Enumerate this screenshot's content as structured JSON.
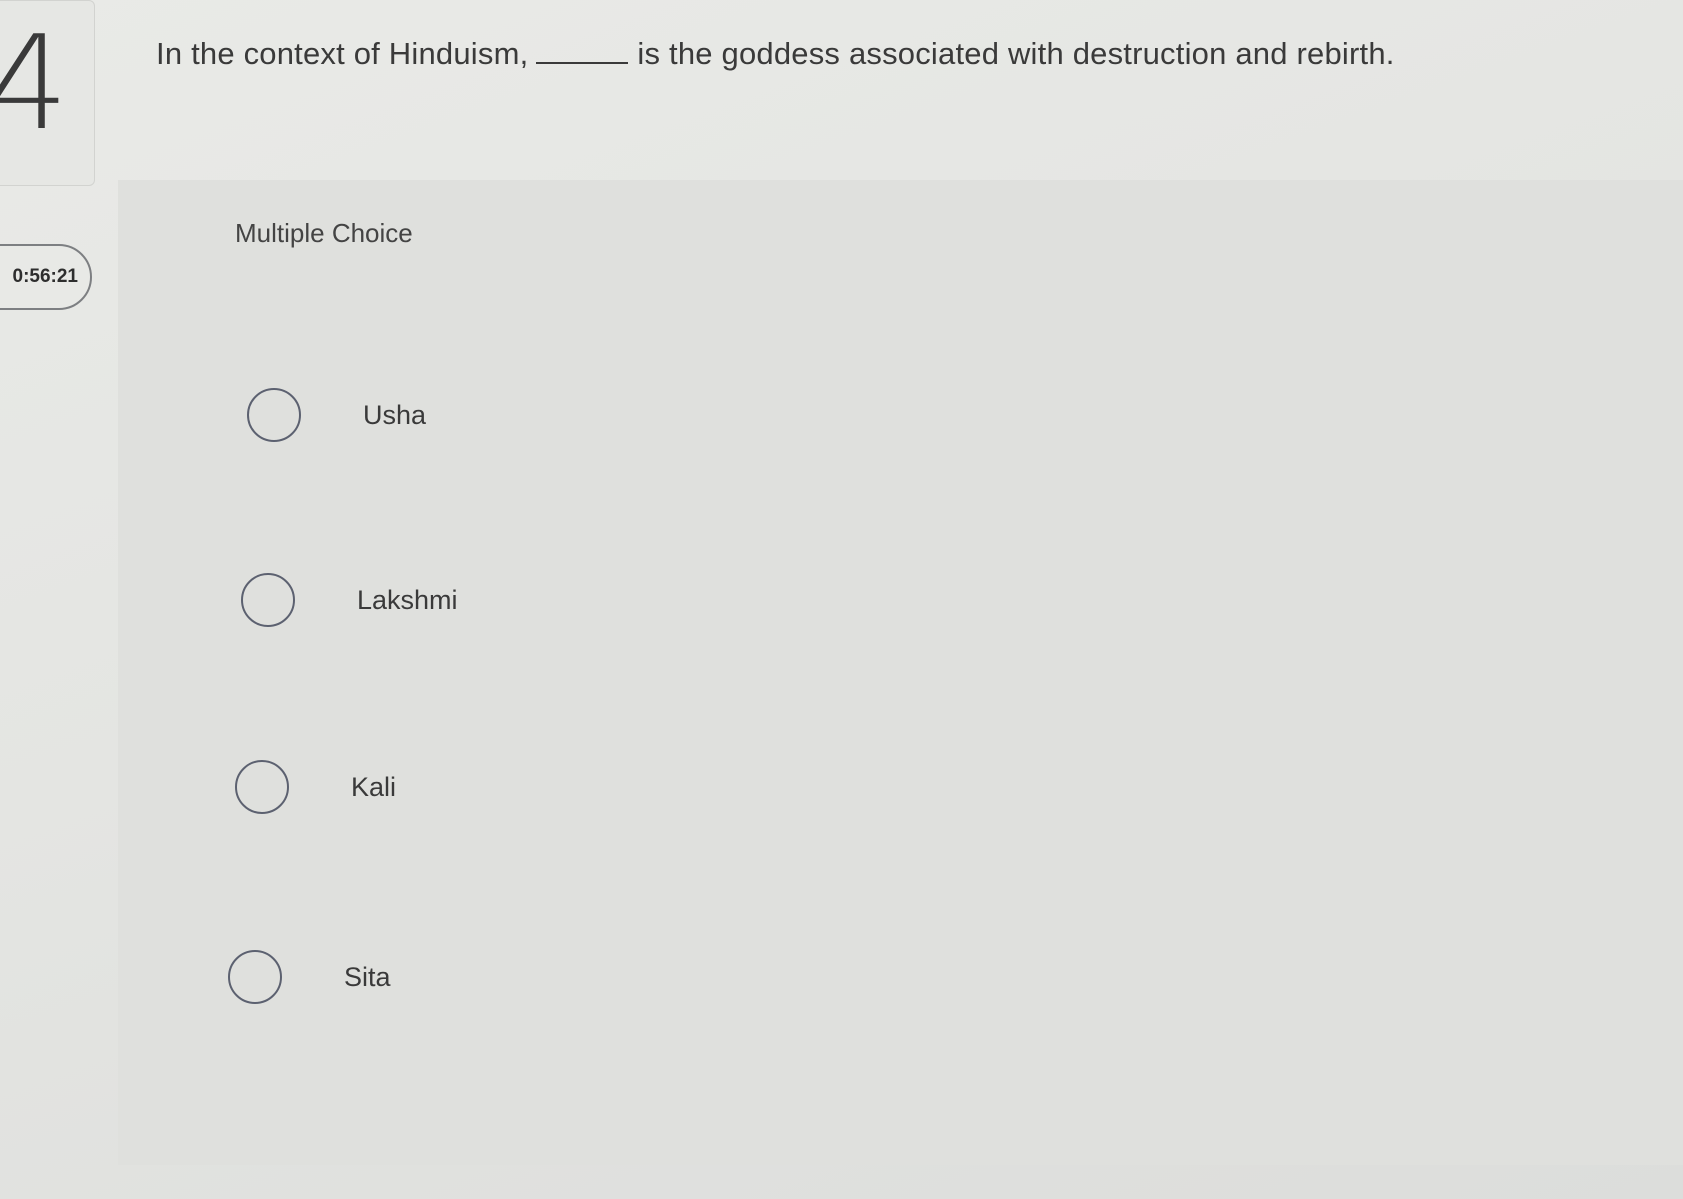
{
  "question": {
    "number": "4",
    "text_before_blank": "In the context of Hinduism,",
    "text_after_blank": "is the goddess associated with destruction and rebirth."
  },
  "timer": {
    "value": "0:56:21"
  },
  "answer_section": {
    "type_label": "Multiple Choice",
    "options": [
      {
        "label": "Usha",
        "selected": false
      },
      {
        "label": "Lakshmi",
        "selected": false
      },
      {
        "label": "Kali",
        "selected": false
      },
      {
        "label": "Sita",
        "selected": false
      }
    ]
  },
  "colors": {
    "background": "#e4e5e2",
    "text": "#3a3a3a",
    "radio_border": "#5c6170"
  }
}
